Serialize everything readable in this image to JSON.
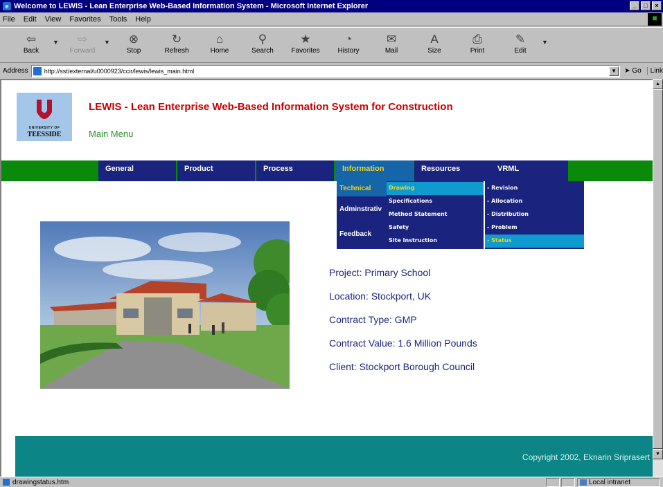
{
  "window": {
    "title": "Welcome to LEWIS - Lean Enterprise Web-Based Information System - Microsoft Internet Explorer",
    "buttons": [
      "_",
      "□",
      "×"
    ]
  },
  "menubar": {
    "items": [
      "File",
      "Edit",
      "View",
      "Favorites",
      "Tools",
      "Help"
    ]
  },
  "toolbar": {
    "items": [
      {
        "label": "Back",
        "icon": "⇦"
      },
      {
        "label": "Forward",
        "icon": "⇨"
      },
      {
        "label": "Stop",
        "icon": "⊗"
      },
      {
        "label": "Refresh",
        "icon": "↻"
      },
      {
        "label": "Home",
        "icon": "⌂"
      },
      {
        "label": "Search",
        "icon": "⚲"
      },
      {
        "label": "Favorites",
        "icon": "★"
      },
      {
        "label": "History",
        "icon": "◔"
      },
      {
        "label": "Mail",
        "icon": "✉"
      },
      {
        "label": "Size",
        "icon": "A"
      },
      {
        "label": "Print",
        "icon": "⎙"
      },
      {
        "label": "Edit",
        "icon": "✎"
      }
    ]
  },
  "address": {
    "label": "Address",
    "url": "http://sst/external/u0000923/ccir/lewis/lewis_main.html",
    "go": "Go",
    "links": "Link"
  },
  "page": {
    "logo_top": "UNIVERSITY OF",
    "logo_bottom": "TEESSIDE",
    "title": "LEWIS - Lean Enterprise Web-Based Information System for Construction",
    "subtitle": "Main Menu"
  },
  "nav": {
    "items": [
      "General",
      "Product",
      "Process",
      "Information",
      "Resources",
      "VRML"
    ],
    "active": "Information"
  },
  "submenu1": {
    "items": [
      "Technical",
      "Adminstrativ",
      "Feedback"
    ]
  },
  "submenu2": {
    "items": [
      "Drawing",
      "Specifications",
      "Method Statement",
      "Safety",
      "Site Instruction"
    ]
  },
  "submenu3": {
    "items": [
      "- Revision",
      "- Allocation",
      "- Distribution",
      "- Problem",
      "- Status"
    ]
  },
  "project": {
    "name": "Project: Primary School",
    "location": "Location: Stockport, UK",
    "contract_type": "Contract Type: GMP",
    "contract_value": "Contract Value: 1.6 Million Pounds",
    "client": "Client: Stockport Borough Council"
  },
  "footer": {
    "copyright": "Copyright 2002, Eknarin Sriprasert"
  },
  "status": {
    "text": "drawingstatus.htm",
    "zone": "Local intranet"
  },
  "colors": {
    "title_red": "#cc0000",
    "nav_green": "#0a8a0a",
    "nav_blue": "#1a237e",
    "active_yellow": "#f2d21a",
    "highlight_cyan": "#0f9bd0",
    "footer_teal": "#0b8585"
  }
}
